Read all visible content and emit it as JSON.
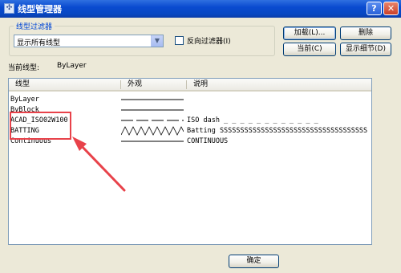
{
  "window": {
    "title": "线型管理器",
    "help_label": "?",
    "close_label": "✕"
  },
  "filter": {
    "group_label": "线型过滤器",
    "selected": "显示所有线型",
    "invert_label": "反向过滤器(I)"
  },
  "buttons": {
    "load": "加载(L)...",
    "delete": "删除",
    "current": "当前(C)",
    "details": "显示细节(D)",
    "ok": "确定"
  },
  "current_linetype": {
    "label": "当前线型:",
    "value": "ByLayer"
  },
  "list": {
    "columns": [
      "线型",
      "外观",
      "说明"
    ],
    "rows": [
      {
        "name": "ByLayer",
        "appearance": "solid",
        "description": ""
      },
      {
        "name": "ByBlock",
        "appearance": "solid",
        "description": ""
      },
      {
        "name": "ACAD_ISO02W100",
        "appearance": "dashed",
        "description": "ISO dash _ _ _ _ _ _ _ _ _ _ _ _"
      },
      {
        "name": "BATTING",
        "appearance": "zigzag",
        "description": "Batting SSSSSSSSSSSSSSSSSSSSSSSSSSSSSSSSSSSS"
      },
      {
        "name": "Continuous",
        "appearance": "solid",
        "description": "CONTINUOUS"
      }
    ]
  },
  "colors": {
    "annotation": "#e8424a",
    "titlebar": "#0a4bd0"
  }
}
